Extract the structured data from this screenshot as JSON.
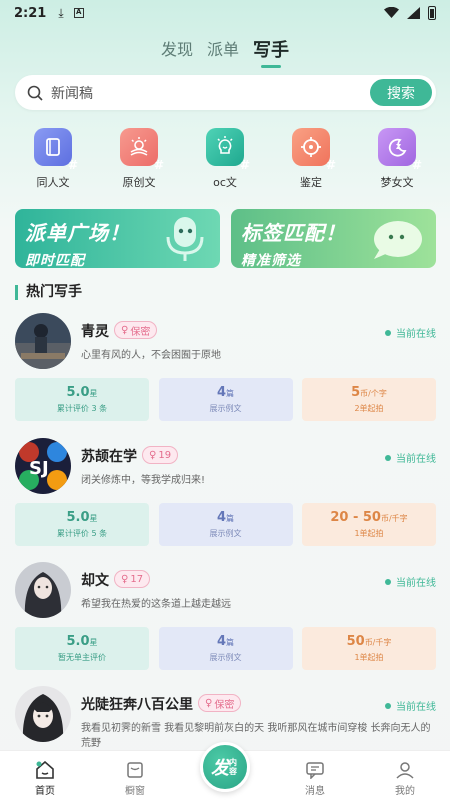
{
  "status": {
    "time": "2:21"
  },
  "tabs": [
    {
      "label": "发现"
    },
    {
      "label": "派单"
    },
    {
      "label": "写手"
    }
  ],
  "search": {
    "placeholder": "新闻稿",
    "button": "搜索"
  },
  "categories": [
    {
      "label": "同人文",
      "icon": "book-icon",
      "color": "#6b7ee8"
    },
    {
      "label": "原创文",
      "icon": "lightbulb-icon",
      "color": "#f07c76"
    },
    {
      "label": "oc文",
      "icon": "idea-person-icon",
      "color": "#2fb9a0"
    },
    {
      "label": "鉴定",
      "icon": "crosshair-icon",
      "color": "#f5876c"
    },
    {
      "label": "梦女文",
      "icon": "moon-icon",
      "color": "#b47ae6"
    }
  ],
  "banners": [
    {
      "title": "派单广场！",
      "subtitle": "即时匹配"
    },
    {
      "title": "标签匹配！",
      "subtitle": "精准筛选"
    }
  ],
  "section_title": "热门写手",
  "online_label": "当前在线",
  "writers": [
    {
      "name": "青灵",
      "badge": "保密",
      "desc": "心里有风的人，不会困囿于原地",
      "rating": "5.0",
      "rating_unit": "星",
      "rating_sub": "累计评价 3 条",
      "works": "4",
      "works_unit": "篇",
      "works_sub": "展示例文",
      "price": "5",
      "price_unit": "币/个字",
      "price_sub": "2单起拍"
    },
    {
      "name": "苏颉在学",
      "badge": "19",
      "desc": "闭关修炼中，等我学成归来!",
      "rating": "5.0",
      "rating_unit": "星",
      "rating_sub": "累计评价 5 条",
      "works": "4",
      "works_unit": "篇",
      "works_sub": "展示例文",
      "price": "20 - 50",
      "price_unit": "币/千字",
      "price_sub": "1单起拍"
    },
    {
      "name": "却文",
      "badge": "17",
      "desc": "希望我在热爱的这条道上越走越远",
      "rating": "5.0",
      "rating_unit": "星",
      "rating_sub": "暂无单主评价",
      "works": "4",
      "works_unit": "篇",
      "works_sub": "展示例文",
      "price": "50",
      "price_unit": "币/千字",
      "price_sub": "1单起拍"
    },
    {
      "name": "光陡狂奔八百公里",
      "badge": "保密",
      "desc": "我看见初霁的新雪 我看见黎明前灰白的天 我听那风在城市间穿梭 长奔向无人的荒野"
    }
  ],
  "bottom_nav": [
    {
      "label": "首页"
    },
    {
      "label": "橱窗"
    },
    {
      "label": "消息"
    },
    {
      "label": "我的"
    }
  ],
  "fab": {
    "main": "发",
    "small": "内容"
  }
}
